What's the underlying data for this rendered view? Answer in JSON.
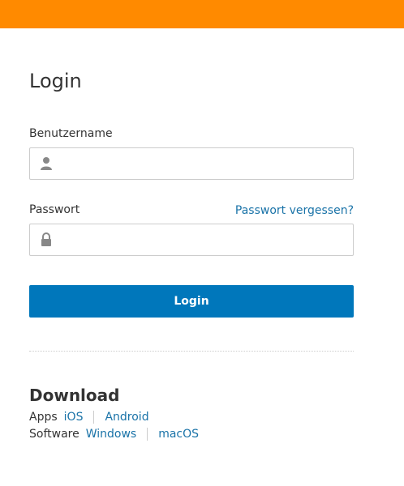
{
  "login": {
    "title": "Login",
    "username_label": "Benutzername",
    "username_value": "",
    "password_label": "Passwort",
    "password_value": "",
    "forgot_link": "Passwort vergessen?",
    "submit_label": "Login"
  },
  "download": {
    "title": "Download",
    "apps_label": "Apps",
    "apps_links": [
      "iOS",
      "Android"
    ],
    "software_label": "Software",
    "software_links": [
      "Windows",
      "macOS"
    ]
  },
  "colors": {
    "top_bar": "#ff8a00",
    "primary_button": "#0077bb",
    "link": "#1a73a8"
  }
}
